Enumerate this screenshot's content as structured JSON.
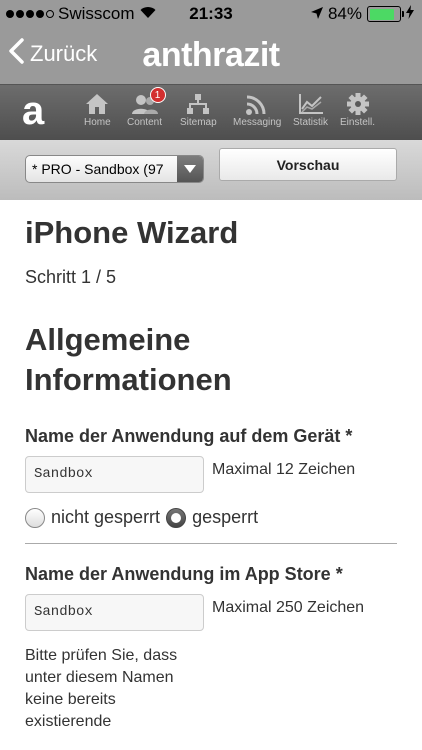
{
  "status_bar": {
    "carrier": "Swisscom",
    "time": "21:33",
    "battery_percent": "84%",
    "battery_level": 0.84,
    "signal_bars": 4
  },
  "nav": {
    "back_label": "Zurück",
    "title": "anthrazit"
  },
  "toolbar": {
    "logo": "a",
    "items": [
      {
        "label": "Home",
        "icon": "home-icon"
      },
      {
        "label": "Content",
        "icon": "users-icon",
        "badge": "1"
      },
      {
        "label": "Sitemap",
        "icon": "sitemap-icon"
      },
      {
        "label": "Messaging",
        "icon": "broadcast-icon"
      },
      {
        "label": "Statistik",
        "icon": "chart-icon"
      },
      {
        "label": "Einstell.",
        "icon": "gear-icon"
      }
    ]
  },
  "selector": {
    "project_value": "* PRO - Sandbox (97",
    "preview_label": "Vorschau"
  },
  "page": {
    "title": "iPhone Wizard",
    "step": "Schritt 1 / 5",
    "section_title": "Allgemeine Informationen",
    "field1": {
      "label": "Name der Anwendung auf dem Gerät *",
      "value": "Sandbox",
      "hint": "Maximal 12 Zeichen"
    },
    "radio": {
      "option1": "nicht gesperrt",
      "option2": "gesperrt",
      "selected": "gesperrt"
    },
    "field2": {
      "label": "Name der Anwendung im App Store *",
      "value": "Sandbox",
      "hint": "Maximal 250 Zeichen",
      "help": "Bitte prüfen Sie, dass unter diesem Namen keine bereits existierende"
    }
  },
  "colors": {
    "header_gray": "#9a9a9a",
    "toolbar_dark": "#5a5a5a",
    "badge_red": "#d32f2f",
    "battery_green": "#4cd964"
  }
}
